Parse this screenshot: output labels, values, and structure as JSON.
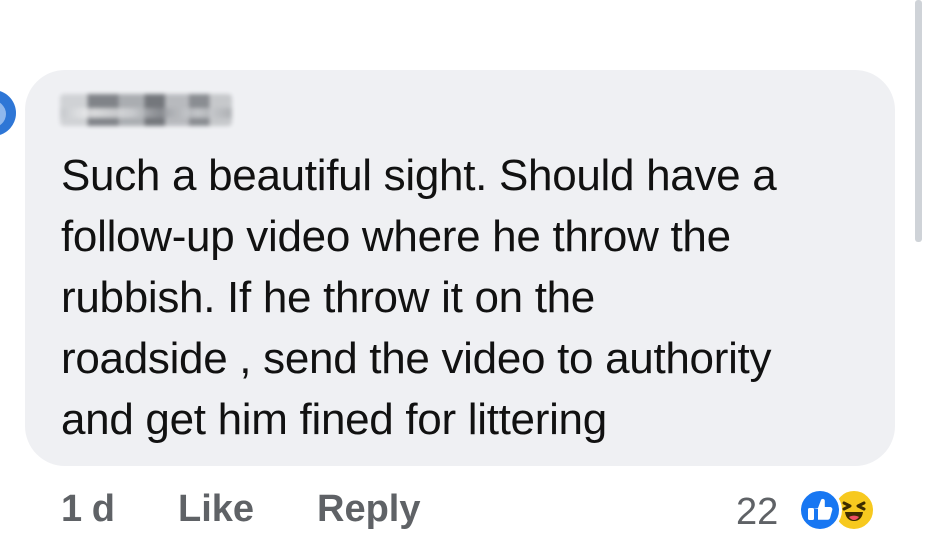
{
  "comment": {
    "author_name": "",
    "text_lines": [
      "Such a beautiful sight. Should have a",
      "follow-up video where he throw the",
      "rubbish. If he throw it on the",
      "roadside , send the video to authority",
      "and get him fined for littering"
    ]
  },
  "actions": {
    "time": "1 d",
    "like_label": "Like",
    "reply_label": "Reply"
  },
  "reactions": {
    "count": "22",
    "icons": [
      "like-reaction-icon",
      "haha-reaction-icon"
    ],
    "colors": {
      "like": "#1877f2",
      "haha": "#f7c91f"
    }
  },
  "colors": {
    "bubble": "#eff0f3",
    "text": "#111111",
    "secondary_text": "#5f6266"
  }
}
